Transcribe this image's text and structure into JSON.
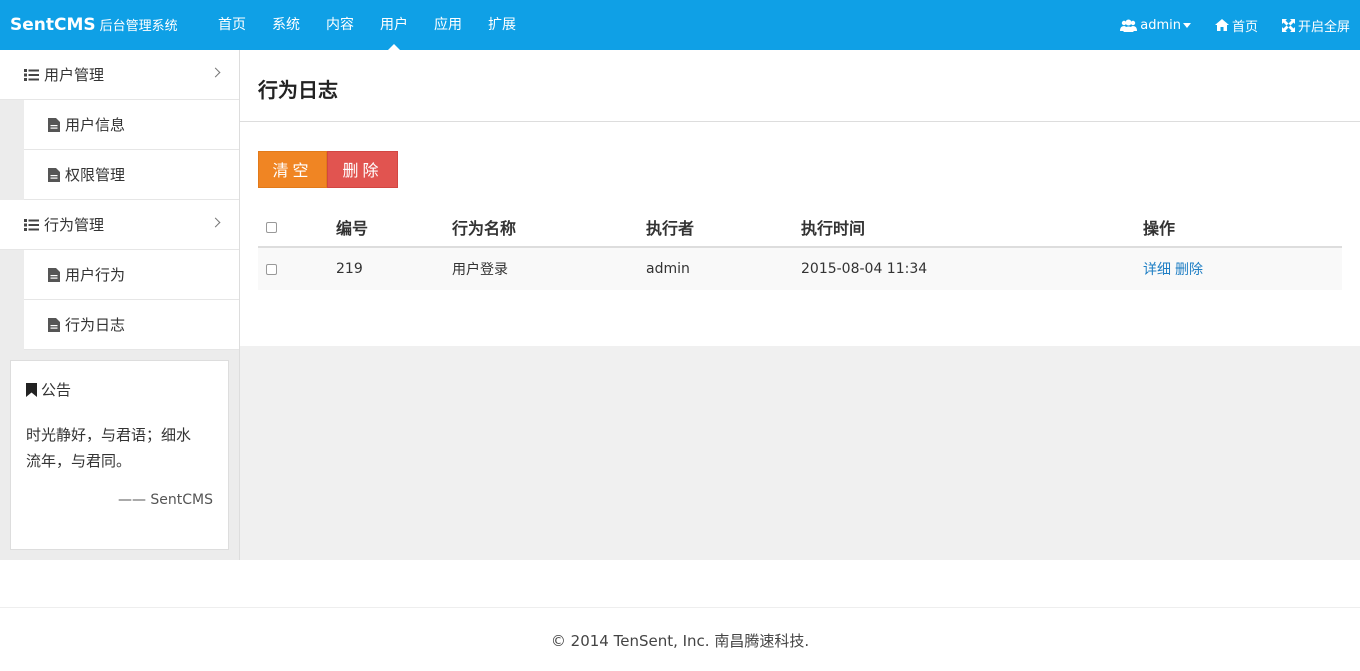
{
  "brand": {
    "name": "SentCMS",
    "subtitle": "后台管理系统"
  },
  "nav": {
    "items": [
      {
        "label": "首页"
      },
      {
        "label": "系统"
      },
      {
        "label": "内容"
      },
      {
        "label": "用户",
        "active": true
      },
      {
        "label": "应用"
      },
      {
        "label": "扩展"
      }
    ],
    "right": {
      "user": "admin",
      "home": "首页",
      "fullscreen": "开启全屏"
    }
  },
  "sidebar": {
    "groups": [
      {
        "label": "用户管理",
        "items": [
          {
            "label": "用户信息"
          },
          {
            "label": "权限管理"
          }
        ]
      },
      {
        "label": "行为管理",
        "items": [
          {
            "label": "用户行为"
          },
          {
            "label": "行为日志"
          }
        ]
      }
    ],
    "notice": {
      "title": "公告",
      "line1": "时光静好，与君语；细水",
      "line2": "流年，与君同。",
      "sign": "—— SentCMS"
    }
  },
  "main": {
    "title": "行为日志",
    "buttons": {
      "clear": "清空",
      "delete": "删除"
    },
    "table": {
      "headers": {
        "id": "编号",
        "action": "行为名称",
        "executor": "执行者",
        "time": "执行时间",
        "ops": "操作"
      },
      "rows": [
        {
          "id": "219",
          "action": "用户登录",
          "executor": "admin",
          "time": "2015-08-04 11:34",
          "detail": "详细",
          "delete": "删除"
        }
      ]
    }
  },
  "footer": {
    "text": "© 2014 TenSent, Inc. 南昌腾速科技."
  },
  "colors": {
    "navbar": "#0fa0e6",
    "clear_button": "#f08523",
    "delete_button": "#e15450",
    "link": "#1e7ec4"
  }
}
